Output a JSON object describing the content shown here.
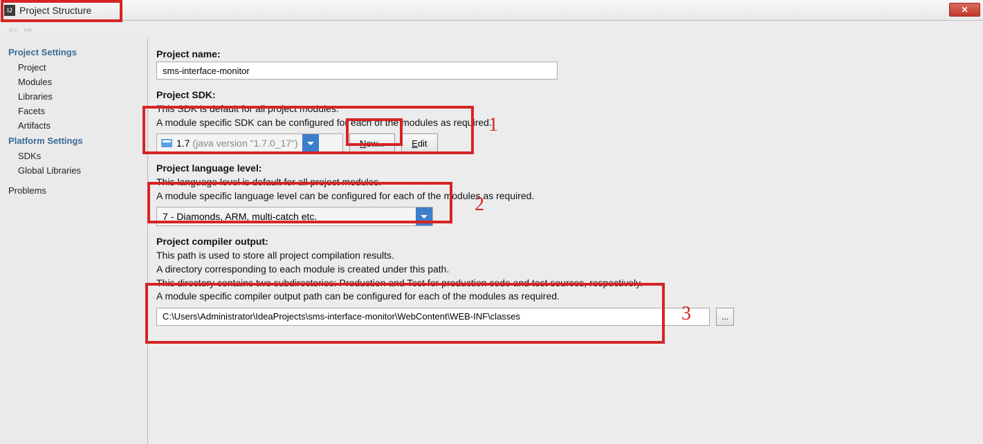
{
  "title": "Project Structure",
  "nav": {
    "back_glyph": "⇦",
    "forward_glyph": "⇨"
  },
  "sidebar": {
    "heading1": "Project Settings",
    "items1": [
      "Project",
      "Modules",
      "Libraries",
      "Facets",
      "Artifacts"
    ],
    "heading2": "Platform Settings",
    "items2": [
      "SDKs",
      "Global Libraries"
    ],
    "problems": "Problems"
  },
  "project_name": {
    "label": "Project name:",
    "value": "sms-interface-monitor"
  },
  "sdk": {
    "label": "Project SDK:",
    "desc1": "This SDK is default for all project modules.",
    "desc2": "A module specific SDK can be configured for each of the modules as required.",
    "combo_main": "1.7",
    "combo_sub": " (java version \"1.7.0_17\")",
    "new_btn_prefix": "N",
    "new_btn_rest": "ew...",
    "edit_btn_prefix": "E",
    "edit_btn_rest": "dit"
  },
  "lang": {
    "label": "Project language level:",
    "desc1": "This language level is default for all project modules.",
    "desc2": "A module specific language level can be configured for each of the modules as required.",
    "combo": "7 - Diamonds, ARM, multi-catch etc."
  },
  "output": {
    "label": "Project compiler output:",
    "desc1": "This path is used to store all project compilation results.",
    "desc2": "A directory corresponding to each module is created under this path.",
    "desc3": "This directory contains two subdirectories: Production and Test for production code and test sources, respectively.",
    "desc4": "A module specific compiler output path can be configured for each of the modules as required.",
    "value": "C:\\Users\\Administrator\\IdeaProjects\\sms-interface-monitor\\WebContent\\WEB-INF\\classes",
    "browse": "..."
  },
  "annotations": {
    "a1": "1",
    "a2": "2",
    "a3": "3"
  }
}
